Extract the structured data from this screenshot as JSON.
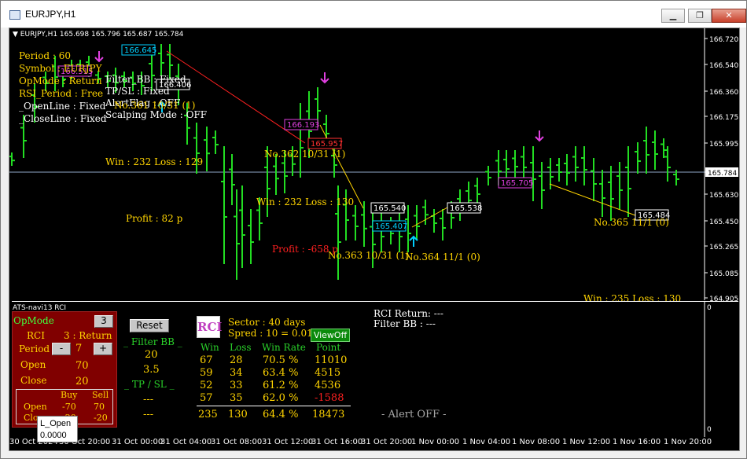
{
  "window": {
    "title": "EURJPY,H1",
    "buttons": [
      "minimize",
      "restore",
      "close"
    ]
  },
  "chart": {
    "header": "EURJPY,H1  165.698 165.796 165.687 165.784",
    "price_labels": [
      "166.720",
      "166.540",
      "166.360",
      "166.175",
      "165.995",
      "165.784",
      "165.630",
      "165.450",
      "165.265",
      "165.085",
      "164.905"
    ],
    "current_price": "165.784",
    "info_left": [
      "Period : 60",
      "Symbol : EURJPY",
      "OpMode : Return",
      "RSI_Period : Free",
      "_OpenLine : Fixed",
      "_CloseLine : Fixed"
    ],
    "info_right": [
      "Filter_BB : Fixed",
      "TP/SL : Fixed",
      "AlertFlag : OFF",
      "Scalping Mode : OFF"
    ],
    "boxes": [
      {
        "text": "166.645",
        "color": "#00d0ff"
      },
      {
        "text": "166.406",
        "color": "#ffffff"
      },
      {
        "text": "166.193",
        "color": "#e040e0"
      },
      {
        "text": "165.957",
        "color": "#ff3030"
      },
      {
        "text": "165.540",
        "color": "#ffffff"
      },
      {
        "text": "165.407",
        "color": "#00d0ff"
      },
      {
        "text": "165.538",
        "color": "#ffffff"
      },
      {
        "text": "165.705",
        "color": "#e040e0"
      },
      {
        "text": "165.484",
        "color": "#ffffff"
      },
      {
        "text": "166.515",
        "color": "#e040e0"
      }
    ],
    "trade_labels": [
      "No.361  10/31 (1)",
      "No.362  10/31 (1)",
      "No.363  10/31 (1)",
      "No.364   11/1 (0)",
      "No.365  11/1 (0)"
    ],
    "stats": [
      "Win : 232   Loss : 129",
      "Win : 232   Loss : 130",
      "Win : 235   Loss : 130"
    ],
    "profits": [
      {
        "text": "Profit : 82 p",
        "color": "#ffd400"
      },
      {
        "text": "Profit : -658 p",
        "color": "#ff2020"
      }
    ]
  },
  "indicator": {
    "label": "ATS-navi13  RCI",
    "scale": [
      "0",
      "0"
    ],
    "rci_return": "RCI Return: ---",
    "filter_bb": "Filter BB  : ---",
    "alert": "- Alert OFF -"
  },
  "control_panel": {
    "opmode_label": "OpMode",
    "opmode_value": "3",
    "rci_label": "RCI",
    "rci_value": "3 : Return",
    "period_label": "Period",
    "period_value": "7",
    "minus": "-",
    "plus": "+",
    "open_label": "Open",
    "open_value": "70",
    "close_label": "Close",
    "close_value": "20",
    "table": {
      "headers": [
        "Buy",
        "Sell"
      ],
      "rows": [
        {
          "label": "Open",
          "buy": "-70",
          "sell": "70"
        },
        {
          "label": "Close",
          "buy": "-20",
          "sell": "-20"
        }
      ]
    }
  },
  "filter_panel": {
    "reset": "Reset",
    "filter_bb_title": "_ Filter BB _",
    "bb_values": [
      "20",
      "3.5"
    ],
    "tpsl_title": "_ TP / SL _",
    "tpsl_values": [
      "---",
      "---"
    ]
  },
  "stats_panel": {
    "logo": "RCI",
    "sector": "Sector : 40 days",
    "spred": "Spred : 10 = 0.010",
    "view_button": "ViewOff",
    "headers": [
      "Win",
      "Loss",
      "Win Rate",
      "Point"
    ],
    "rows": [
      {
        "win": "67",
        "loss": "28",
        "rate": "70.5 %",
        "point": "11010",
        "neg": false
      },
      {
        "win": "59",
        "loss": "34",
        "rate": "63.4 %",
        "point": "4515",
        "neg": false
      },
      {
        "win": "52",
        "loss": "33",
        "rate": "61.2 %",
        "point": "4536",
        "neg": false
      },
      {
        "win": "57",
        "loss": "35",
        "rate": "62.0 %",
        "point": "-1588",
        "neg": true
      }
    ],
    "total": {
      "win": "235",
      "loss": "130",
      "rate": "64.4 %",
      "point": "18473"
    }
  },
  "tooltip": {
    "title": "L_Open",
    "value": "0.0000"
  },
  "time_axis": [
    "30 Oct 2024",
    "30 Oct 20:00",
    "31 Oct 00:00",
    "31 Oct 04:00",
    "31 Oct 08:00",
    "31 Oct 12:00",
    "31 Oct 16:00",
    "31 Oct 20:00",
    "1 Nov 00:00",
    "1 Nov 04:00",
    "1 Nov 08:00",
    "1 Nov 12:00",
    "1 Nov 16:00",
    "1 Nov 20:00"
  ]
}
